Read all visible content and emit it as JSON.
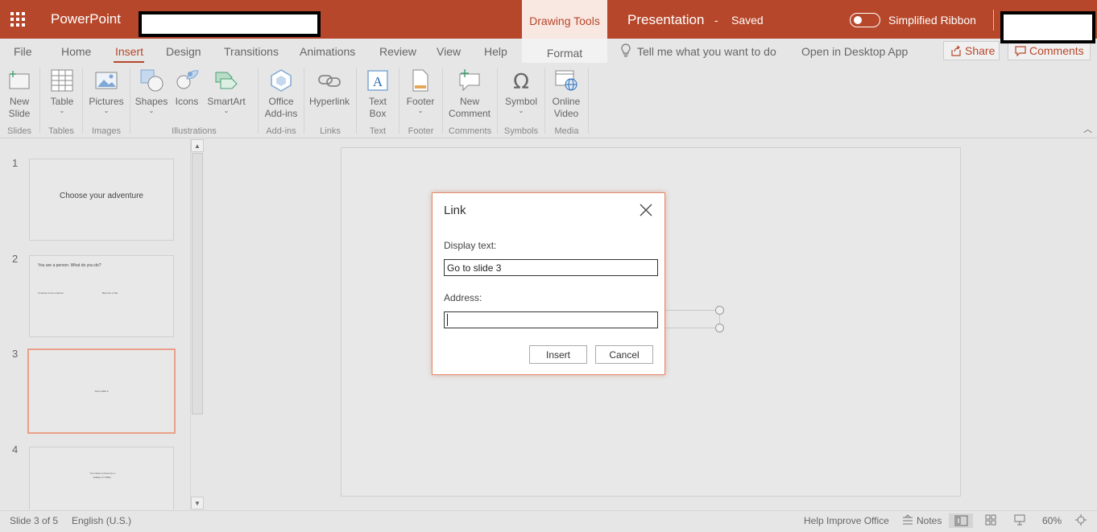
{
  "colors": {
    "brand": "#b7472a",
    "ribbon_bg": "#e6e6e6",
    "dialog_border": "#e08a6a"
  },
  "titlebar": {
    "app_name": "PowerPoint",
    "context_tab": "Drawing Tools",
    "presentation_title": "Presentation",
    "separator": "-",
    "save_status": "Saved",
    "simplified_ribbon_label": "Simplified Ribbon"
  },
  "tabs": [
    {
      "label": "File"
    },
    {
      "label": "Home"
    },
    {
      "label": "Insert"
    },
    {
      "label": "Design"
    },
    {
      "label": "Transitions"
    },
    {
      "label": "Animations"
    },
    {
      "label": "Review"
    },
    {
      "label": "View"
    },
    {
      "label": "Help"
    }
  ],
  "format_tab": "Format",
  "tell_me": "Tell me what you want to do",
  "open_desktop": "Open in Desktop App",
  "share_label": "Share",
  "comments_label": "Comments",
  "ribbon": {
    "buttons": [
      {
        "line1": "New",
        "line2": "Slide",
        "icon": "new-slide-icon"
      },
      {
        "line1": "Table",
        "line2": "",
        "icon": "table-icon"
      },
      {
        "line1": "Pictures",
        "line2": "",
        "icon": "pictures-icon"
      },
      {
        "line1": "Shapes",
        "line2": "",
        "icon": "shapes-icon"
      },
      {
        "line1": "Icons",
        "line2": "",
        "icon": "icons-icon"
      },
      {
        "line1": "SmartArt",
        "line2": "",
        "icon": "smartart-icon"
      },
      {
        "line1": "Office",
        "line2": "Add-ins",
        "icon": "office-addins-icon"
      },
      {
        "line1": "Hyperlink",
        "line2": "",
        "icon": "hyperlink-icon"
      },
      {
        "line1": "Text",
        "line2": "Box",
        "icon": "text-box-icon"
      },
      {
        "line1": "Footer",
        "line2": "",
        "icon": "footer-icon"
      },
      {
        "line1": "New",
        "line2": "Comment",
        "icon": "new-comment-icon"
      },
      {
        "line1": "Symbol",
        "line2": "",
        "icon": "symbol-icon"
      },
      {
        "line1": "Online",
        "line2": "Video",
        "icon": "online-video-icon"
      }
    ],
    "groups": [
      "Slides",
      "Tables",
      "Images",
      "Illustrations",
      "Add-ins",
      "Links",
      "Text",
      "Footer",
      "Comments",
      "Symbols",
      "Media"
    ]
  },
  "slides": [
    {
      "number": "1",
      "text": "Choose your adventure"
    },
    {
      "number": "2",
      "text": "You are a person. What do you do?",
      "option_a": "Continue to be a person",
      "option_b": "Become a Tea"
    },
    {
      "number": "3",
      "text": "Go to slide 3"
    },
    {
      "number": "4",
      "text": "You chose to become a teabag. It's Milky."
    }
  ],
  "dialog": {
    "title": "Link",
    "display_text_label": "Display text:",
    "display_text_value": "Go to slide 3",
    "address_label": "Address:",
    "address_value": "",
    "insert_label": "Insert",
    "cancel_label": "Cancel"
  },
  "status": {
    "slide_info": "Slide 3 of 5",
    "language": "English (U.S.)",
    "help_improve": "Help Improve Office",
    "notes": "Notes",
    "zoom": "60%"
  }
}
